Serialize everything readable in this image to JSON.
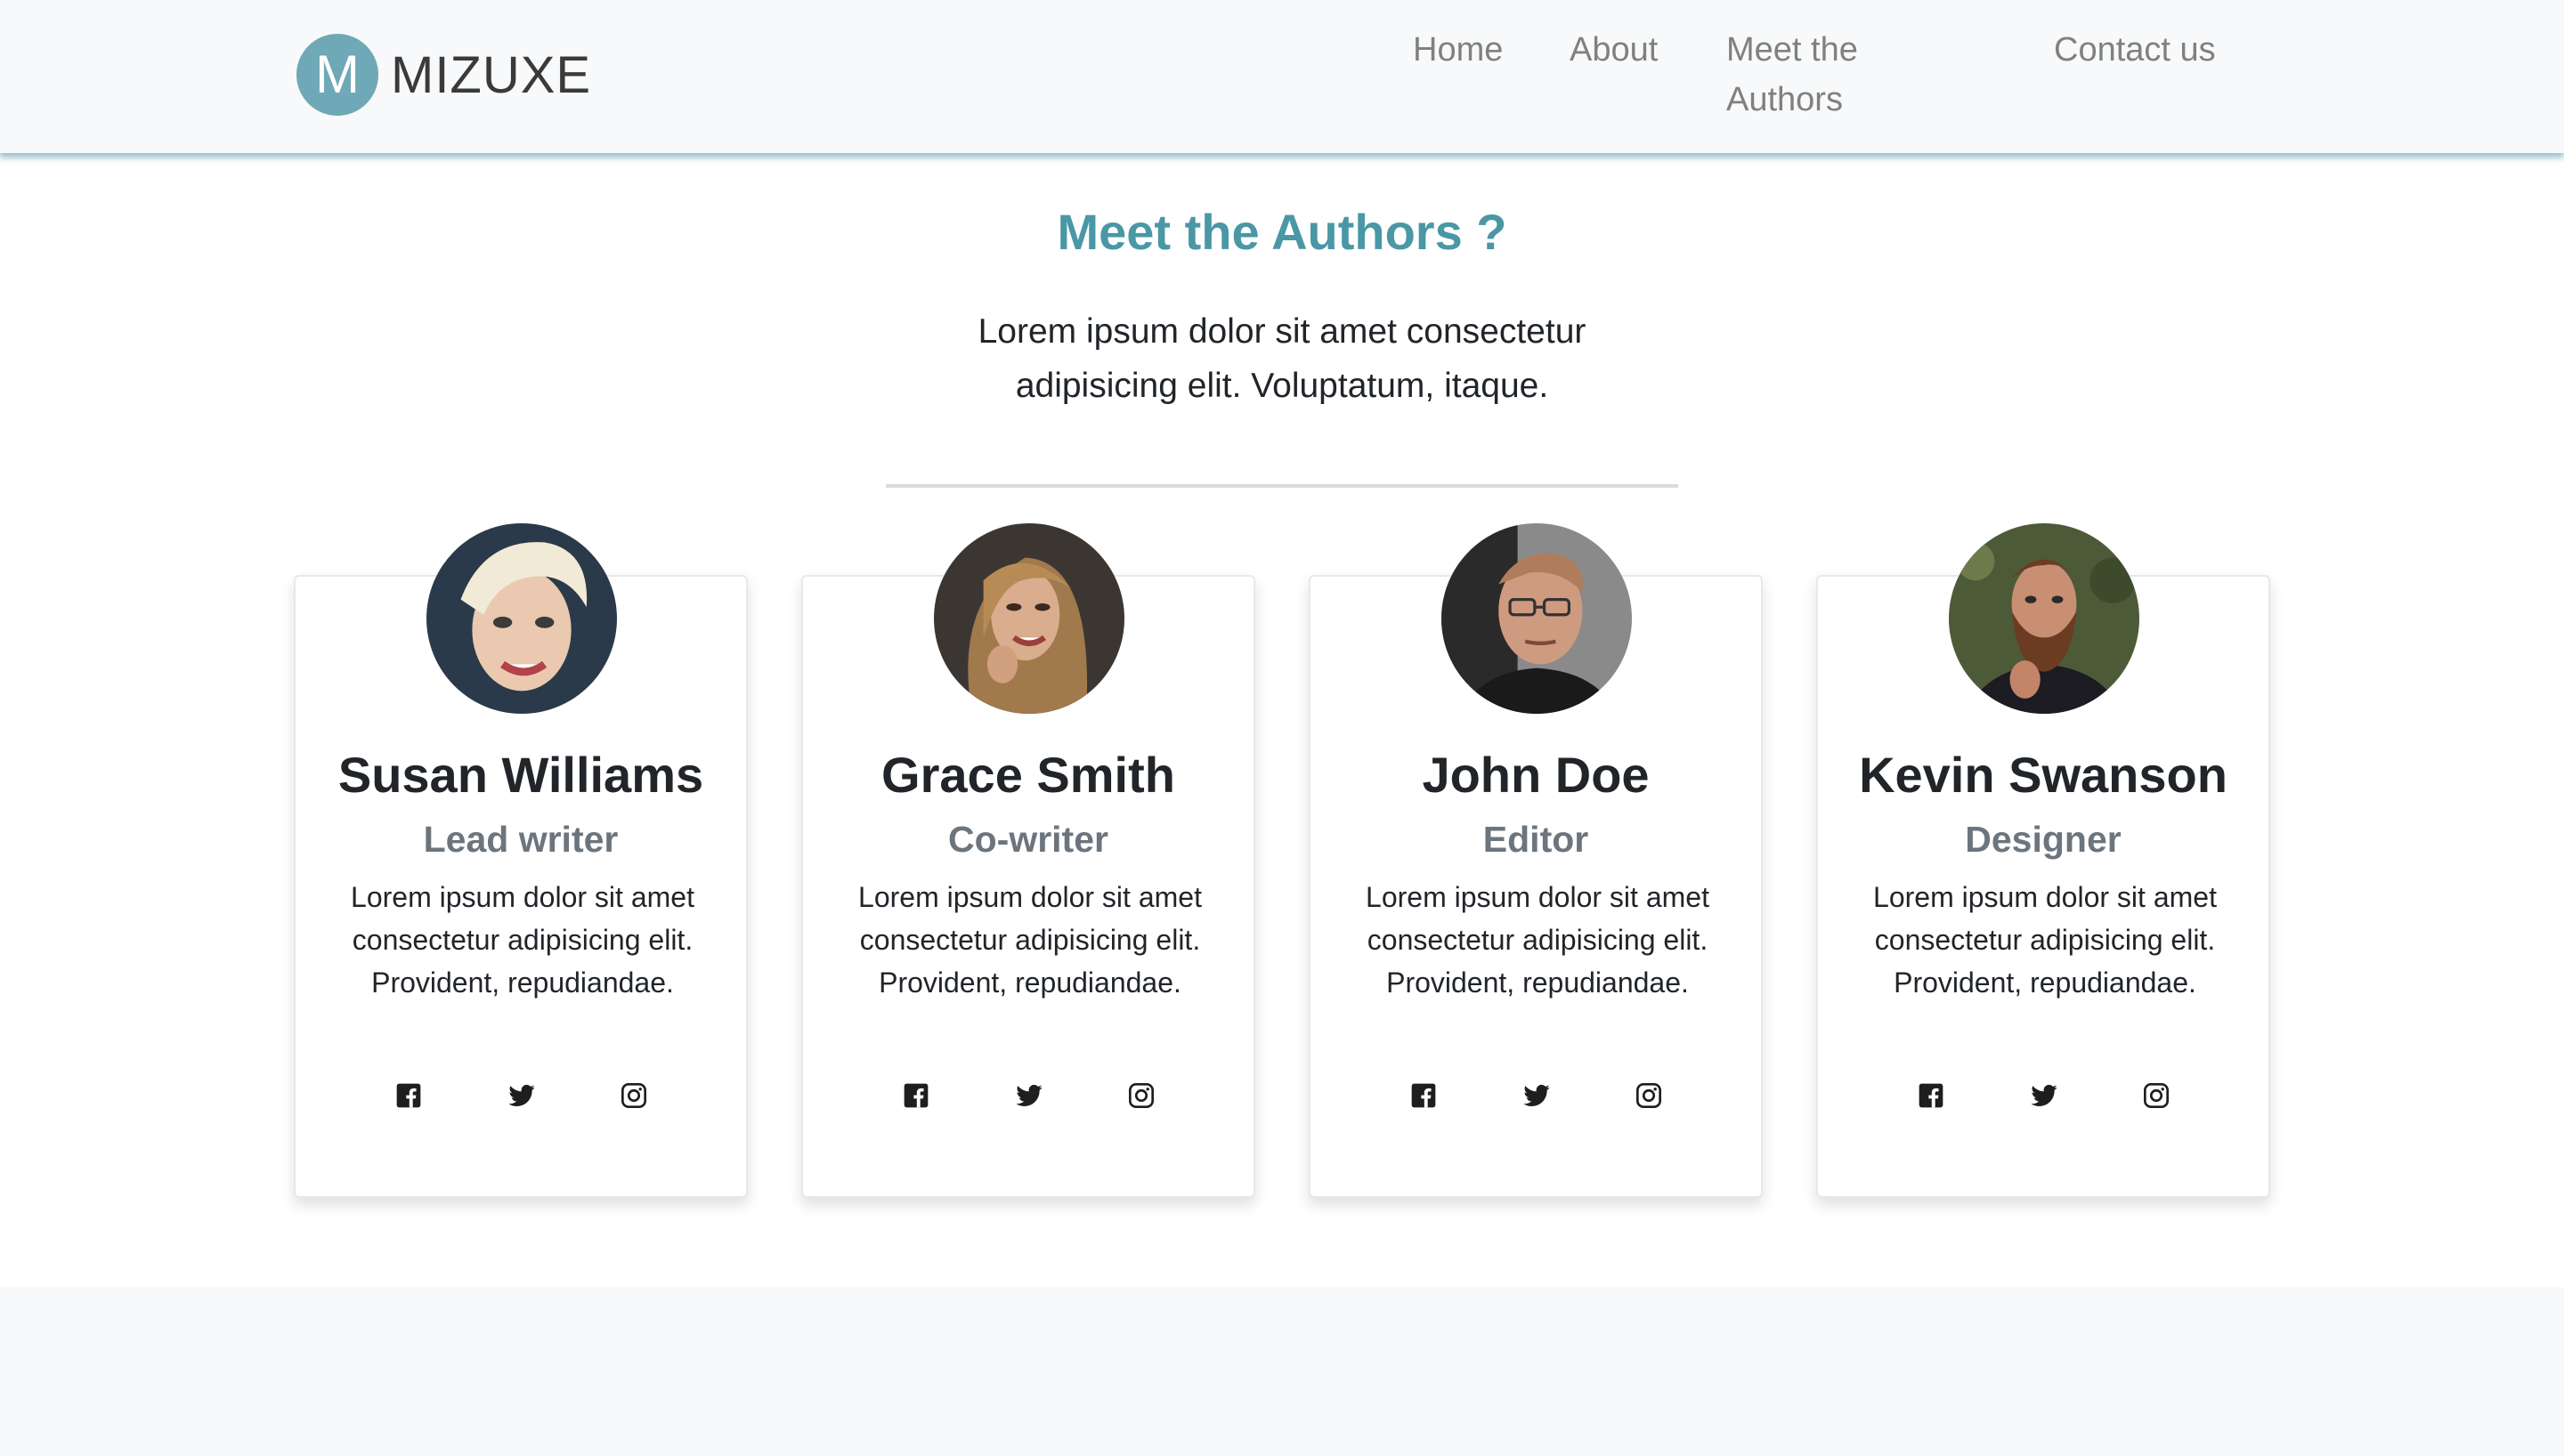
{
  "brand": {
    "logo_letter": "M",
    "name": "MIZUXE",
    "logo_color": "#6fa8b6"
  },
  "nav": {
    "home": "Home",
    "about": "About",
    "authors": "Meet the Authors",
    "contact": "Contact us"
  },
  "hero": {
    "title": "Meet the Authors ?",
    "lead": "Lorem ipsum dolor sit amet consectetur adipisicing elit. Voluptatum, itaque.",
    "accent_color": "#4a97a5"
  },
  "authors": [
    {
      "name": "Susan Williams",
      "role": "Lead writer",
      "bio": "Lorem ipsum dolor sit amet consectetur adipisicing elit. Provident, repudiandae."
    },
    {
      "name": "Grace Smith",
      "role": "Co-writer",
      "bio": "Lorem ipsum dolor sit amet consectetur adipisicing elit. Provident, repudiandae."
    },
    {
      "name": "John Doe",
      "role": "Editor",
      "bio": "Lorem ipsum dolor sit amet consectetur adipisicing elit. Provident, repudiandae."
    },
    {
      "name": "Kevin Swanson",
      "role": "Designer",
      "bio": "Lorem ipsum dolor sit amet consectetur adipisicing elit. Provident, repudiandae."
    }
  ],
  "social_icons": [
    "facebook-icon",
    "twitter-icon",
    "instagram-icon"
  ]
}
